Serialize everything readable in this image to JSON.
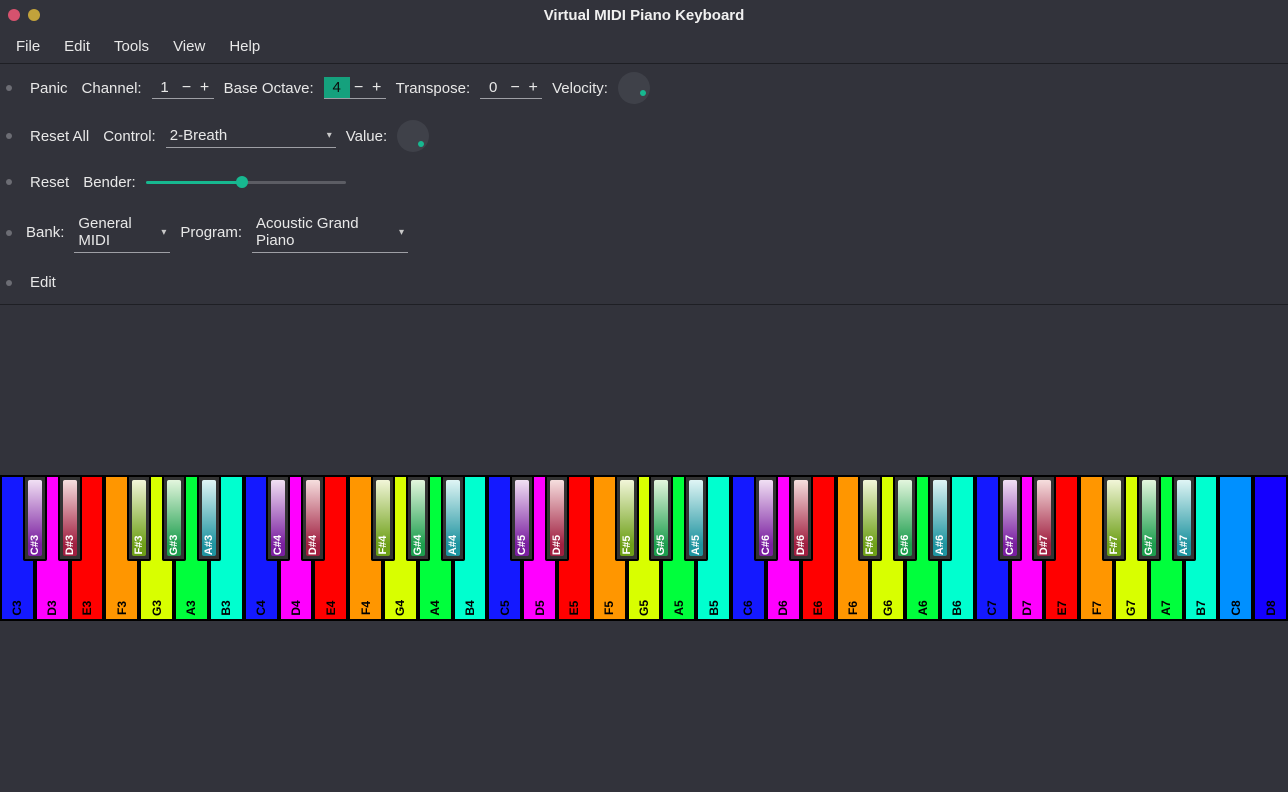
{
  "window": {
    "title": "Virtual MIDI Piano Keyboard"
  },
  "menu": {
    "file": "File",
    "edit": "Edit",
    "tools": "Tools",
    "view": "View",
    "help": "Help"
  },
  "row1": {
    "panic": "Panic",
    "channel_label": "Channel:",
    "channel_value": "1",
    "base_octave_label": "Base Octave:",
    "base_octave_value": "4",
    "transpose_label": "Transpose:",
    "transpose_value": "0",
    "velocity_label": "Velocity:"
  },
  "row2": {
    "reset_all": "Reset All",
    "control_label": "Control:",
    "control_value": "2-Breath",
    "value_label": "Value:"
  },
  "row3": {
    "reset": "Reset",
    "bender_label": "Bender:",
    "bender_position_pct": 48
  },
  "row4": {
    "bank_label": "Bank:",
    "bank_value": "General MIDI",
    "program_label": "Program:",
    "program_value": "Acoustic Grand Piano"
  },
  "row5": {
    "edit_label": "Edit"
  },
  "piano": {
    "octaves": [
      3,
      4,
      5,
      6,
      7
    ],
    "white_colors": [
      "c-blue",
      "c-mag",
      "c-red",
      "c-orange",
      "c-yellow",
      "c-green",
      "c-teal"
    ],
    "tail_colors": [
      "c-sky",
      "c-dblue"
    ],
    "white_names": [
      "C",
      "D",
      "E",
      "F",
      "G",
      "A",
      "B"
    ],
    "black_sets": [
      {
        "pos": 1,
        "name": "C#",
        "cls": "bi-purple"
      },
      {
        "pos": 2,
        "name": "D#",
        "cls": "bi-rose"
      },
      {
        "pos": 4,
        "name": "F#",
        "cls": "bi-lime"
      },
      {
        "pos": 5,
        "name": "G#",
        "cls": "bi-green2"
      },
      {
        "pos": 6,
        "name": "A#",
        "cls": "bi-cyan"
      }
    ]
  }
}
